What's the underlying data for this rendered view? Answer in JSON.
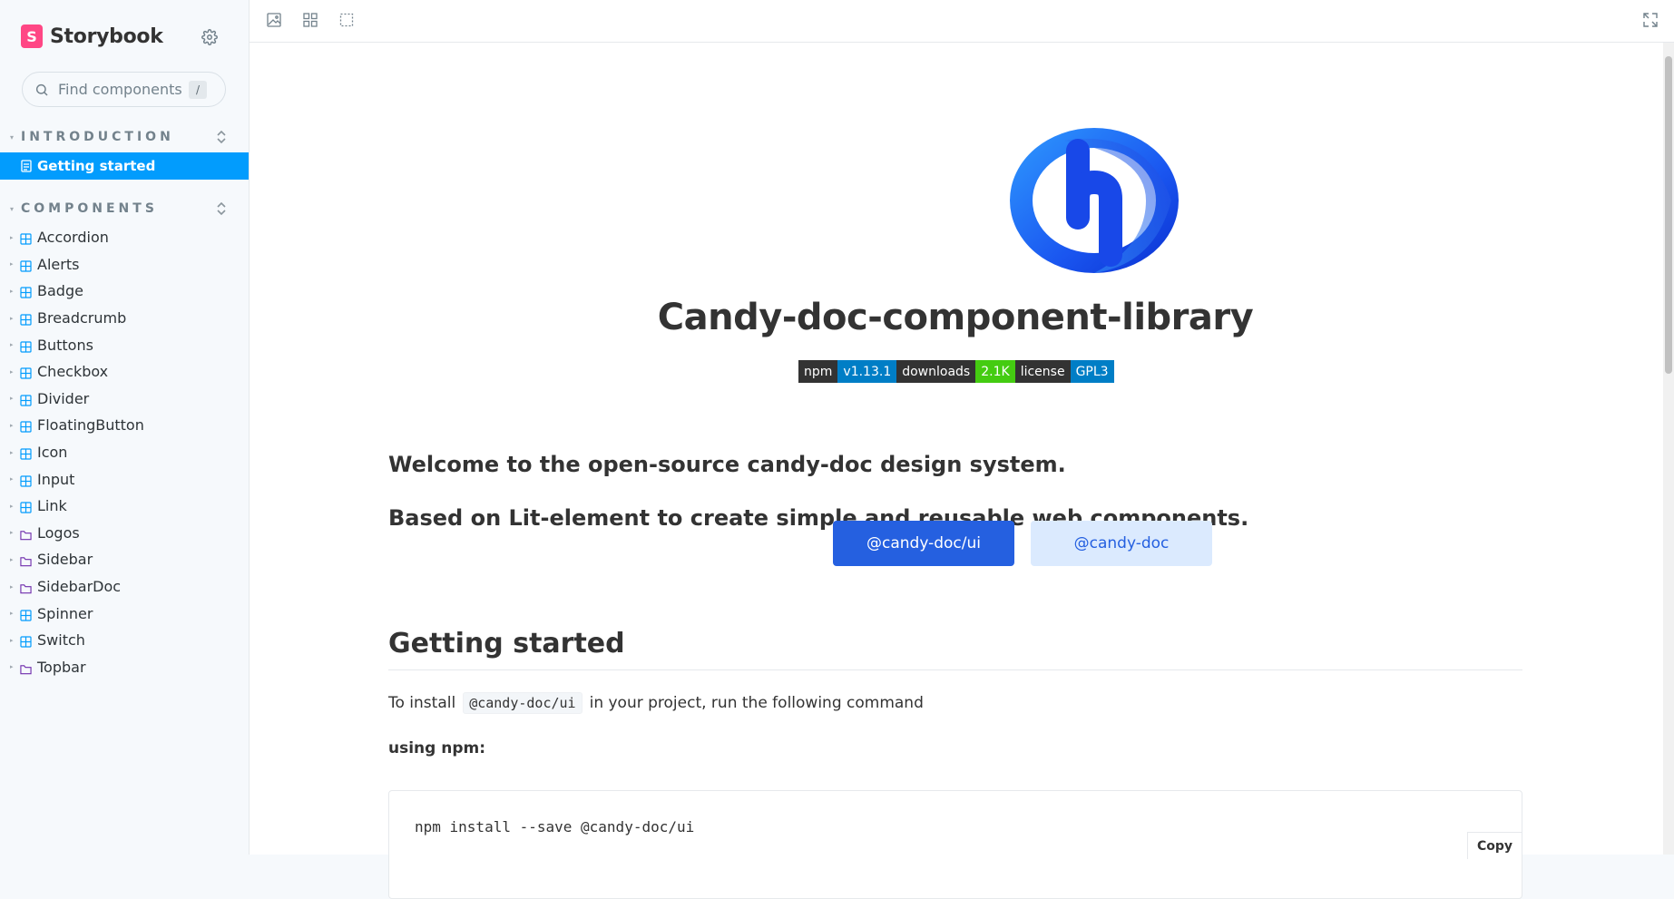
{
  "app": {
    "brand": "Storybook",
    "brand_letter": "S"
  },
  "search": {
    "placeholder": "Find components",
    "shortcut": "/"
  },
  "sidebar": {
    "introduction": {
      "title": "INTRODUCTION",
      "items": [
        {
          "label": "Getting started",
          "type": "doc",
          "active": true
        }
      ]
    },
    "components": {
      "title": "COMPONENTS",
      "items": [
        {
          "label": "Accordion",
          "type": "component"
        },
        {
          "label": "Alerts",
          "type": "component"
        },
        {
          "label": "Badge",
          "type": "component"
        },
        {
          "label": "Breadcrumb",
          "type": "component"
        },
        {
          "label": "Buttons",
          "type": "component"
        },
        {
          "label": "Checkbox",
          "type": "component"
        },
        {
          "label": "Divider",
          "type": "component"
        },
        {
          "label": "FloatingButton",
          "type": "component"
        },
        {
          "label": "Icon",
          "type": "component"
        },
        {
          "label": "Input",
          "type": "component"
        },
        {
          "label": "Link",
          "type": "component"
        },
        {
          "label": "Logos",
          "type": "folder"
        },
        {
          "label": "Sidebar",
          "type": "folder"
        },
        {
          "label": "SidebarDoc",
          "type": "folder"
        },
        {
          "label": "Spinner",
          "type": "component"
        },
        {
          "label": "Switch",
          "type": "component"
        },
        {
          "label": "Topbar",
          "type": "folder"
        }
      ]
    }
  },
  "toolbar": {
    "icons": [
      "image-icon",
      "grid-icon",
      "outline-icon",
      "fullscreen-icon"
    ]
  },
  "doc": {
    "title": "Candy-doc-component-library",
    "badges": [
      {
        "label": "npm",
        "value": "v1.13.1",
        "color": "#007ec6"
      },
      {
        "label": "downloads",
        "value": "2.1K",
        "color": "#44cc11"
      },
      {
        "label": "license",
        "value": "GPL3",
        "color": "#007ec6"
      }
    ],
    "lead1": "Welcome to the open-source candy-doc design system.",
    "lead2": "Based on Lit-element to create simple and reusable web components.",
    "btn_primary": "@candy-doc/ui",
    "btn_secondary": "@candy-doc",
    "section_title": "Getting started",
    "install_pre": "To install",
    "install_code": "@candy-doc/ui",
    "install_post": "in your project, run the following command",
    "npm_heading": "using npm:",
    "npm_command": "npm install --save @candy-doc/ui",
    "copy_label": "Copy"
  },
  "colors": {
    "accent": "#029cfd",
    "brand": "#ff4785",
    "primary_button": "#2560e0",
    "component_icon": "#029cfd",
    "folder_icon": "#6f2cac"
  }
}
